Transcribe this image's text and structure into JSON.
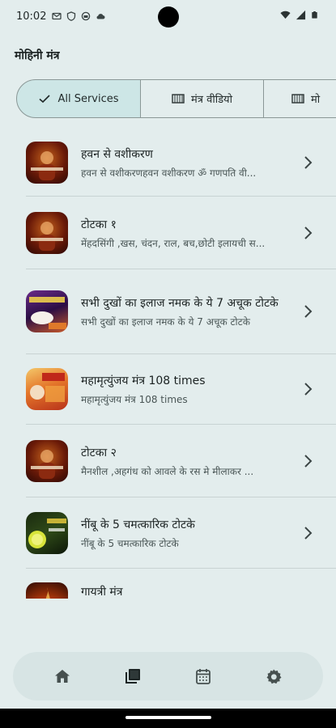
{
  "status_bar": {
    "time": "10:02",
    "left_icons": [
      "mail-icon",
      "shield-icon",
      "android-icon",
      "cloud-icon"
    ],
    "right_icons": [
      "wifi-icon",
      "signal-icon",
      "battery-icon"
    ]
  },
  "header": {
    "title": "मोहिनी मंत्र"
  },
  "tabs": [
    {
      "label": "All Services",
      "icon": "check-icon",
      "selected": true
    },
    {
      "label": "मंत्र वीडियो",
      "icon": "film-icon",
      "selected": false
    },
    {
      "label": "मो",
      "icon": "film-icon",
      "selected": false
    }
  ],
  "items": [
    {
      "title": "हवन से वशीकरण",
      "subtitle": "हवन से वशीकरणहवन वशीकरण ॐ गणपति वी...",
      "thumb": "dark-red"
    },
    {
      "title": "टोटका १",
      "subtitle": "मेंहदसिंगी ,खस, चंदन, राल, बच,छोटी इलायची स...",
      "thumb": "dark-red"
    },
    {
      "title": "सभी दुखों का इलाज नमक के ये 7 अचूक टोटके",
      "subtitle": "सभी दुखों का इलाज नमक के ये 7 अचूक टोटके",
      "thumb": "purple"
    },
    {
      "title": "महामृत्युंजय मंत्र 108 times",
      "subtitle": "महामृत्युंजय मंत्र 108 times",
      "thumb": "orange"
    },
    {
      "title": "टोटका २",
      "subtitle": "मैनशील ,अहगंध को आवले के रस मे मीलाकर ...",
      "thumb": "dark-red"
    },
    {
      "title": "नींबू के 5 चमत्कारिक टोटके",
      "subtitle": "नींबू के 5 चमत्कारिक टोटके",
      "thumb": "green"
    },
    {
      "title": "गायत्री मंत्र",
      "subtitle": "",
      "thumb": "fire"
    }
  ],
  "bottom_nav": [
    {
      "icon": "home-icon",
      "active": false
    },
    {
      "icon": "library-icon",
      "active": true
    },
    {
      "icon": "calendar-icon",
      "active": false
    },
    {
      "icon": "settings-icon",
      "active": false
    }
  ],
  "colors": {
    "background": "#e3eded",
    "selected_tab": "#cde6e6",
    "nav_background": "#d7e4e4"
  }
}
